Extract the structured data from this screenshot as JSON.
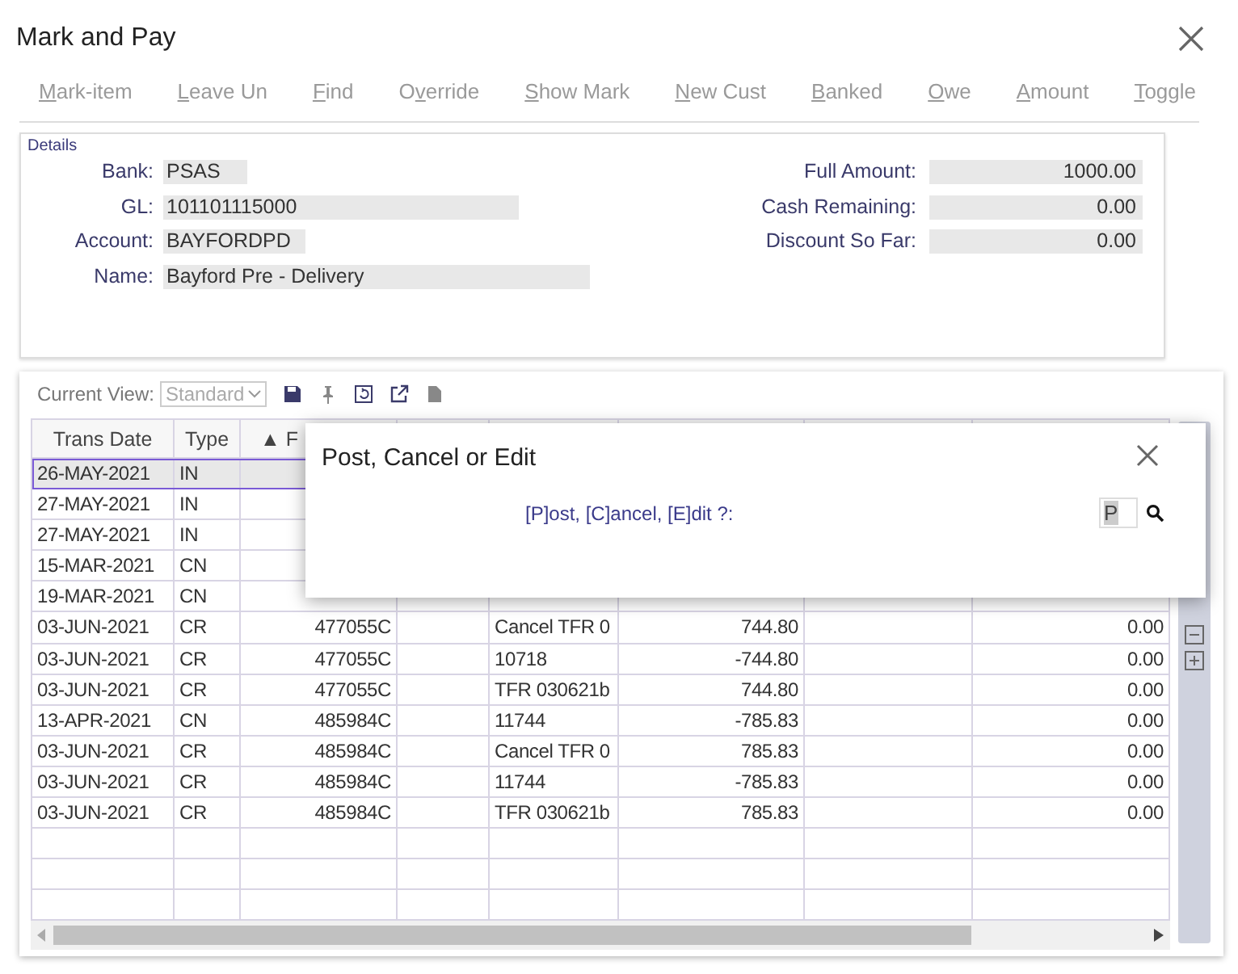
{
  "window": {
    "title": "Mark and Pay"
  },
  "toolbar": [
    {
      "key": "M",
      "after": "ark-item"
    },
    {
      "key": "L",
      "after": "eave Un"
    },
    {
      "key": "F",
      "after": "ind"
    },
    {
      "before": "O",
      "key": "v",
      "after": "erride"
    },
    {
      "key": "S",
      "after": "how Mark"
    },
    {
      "key": "N",
      "after": "ew Cust"
    },
    {
      "key": "B",
      "after": "anked"
    },
    {
      "key": "O",
      "after": "we"
    },
    {
      "key": "A",
      "after": "mount"
    },
    {
      "key": "T",
      "after": "oggle"
    }
  ],
  "details": {
    "title": "Details",
    "left": [
      {
        "label": "Bank:",
        "value": "PSAS"
      },
      {
        "label": "GL:",
        "value": "101101115000"
      },
      {
        "label": "Account:",
        "value": "BAYFORDPD"
      },
      {
        "label": "Name:",
        "value": "Bayford Pre - Delivery"
      }
    ],
    "right": [
      {
        "label": "Full Amount:",
        "value": "1000.00"
      },
      {
        "label": "Cash Remaining:",
        "value": "0.00"
      },
      {
        "label": "Discount So Far:",
        "value": "0.00"
      }
    ]
  },
  "grid": {
    "current_view_label": "Current View:",
    "current_view": "Standard",
    "columns": [
      "Trans Date",
      "Type",
      "▲ F"
    ],
    "rows": [
      {
        "date": "26-MAY-2021",
        "type": "IN",
        "selected": true
      },
      {
        "date": "27-MAY-2021",
        "type": "IN",
        "selected": false
      },
      {
        "date": "27-MAY-2021",
        "type": "IN",
        "selected": false
      },
      {
        "date": "15-MAR-2021",
        "type": "CN",
        "selected": false
      },
      {
        "date": "19-MAR-2021",
        "type": "CN",
        "selected": false
      },
      {
        "date": "03-JUN-2021",
        "type": "CR",
        "column_3": "477055C",
        "column_5": "Cancel TFR 0",
        "column_6": "744.80",
        "column_8": "0.00",
        "selected": false
      },
      {
        "date": "03-JUN-2021",
        "type": "CR",
        "column_3": "477055C",
        "column_5": "10718",
        "column_6": "-744.80",
        "column_8": "0.00",
        "selected": false
      },
      {
        "date": "03-JUN-2021",
        "type": "CR",
        "column_3": "477055C",
        "column_5": "TFR 030621b",
        "column_6": "744.80",
        "column_8": "0.00",
        "selected": false
      },
      {
        "date": "13-APR-2021",
        "type": "CN",
        "column_3": "485984C",
        "column_5": "11744",
        "column_6": "-785.83",
        "column_8": "0.00",
        "selected": false
      },
      {
        "date": "03-JUN-2021",
        "type": "CR",
        "column_3": "485984C",
        "column_5": "Cancel TFR 0",
        "column_6": "785.83",
        "column_8": "0.00",
        "selected": false
      },
      {
        "date": "03-JUN-2021",
        "type": "CR",
        "column_3": "485984C",
        "column_5": "11744",
        "column_6": "-785.83",
        "column_8": "0.00",
        "selected": false
      },
      {
        "date": "03-JUN-2021",
        "type": "CR",
        "column_3": "485984C",
        "column_5": "TFR 030621b",
        "column_6": "785.83",
        "column_8": "0.00",
        "selected": false
      }
    ]
  },
  "dialog": {
    "title": "Post, Cancel or Edit",
    "prompt": "[P]ost, [C]ancel, [E]dit ?:",
    "value": "P"
  }
}
